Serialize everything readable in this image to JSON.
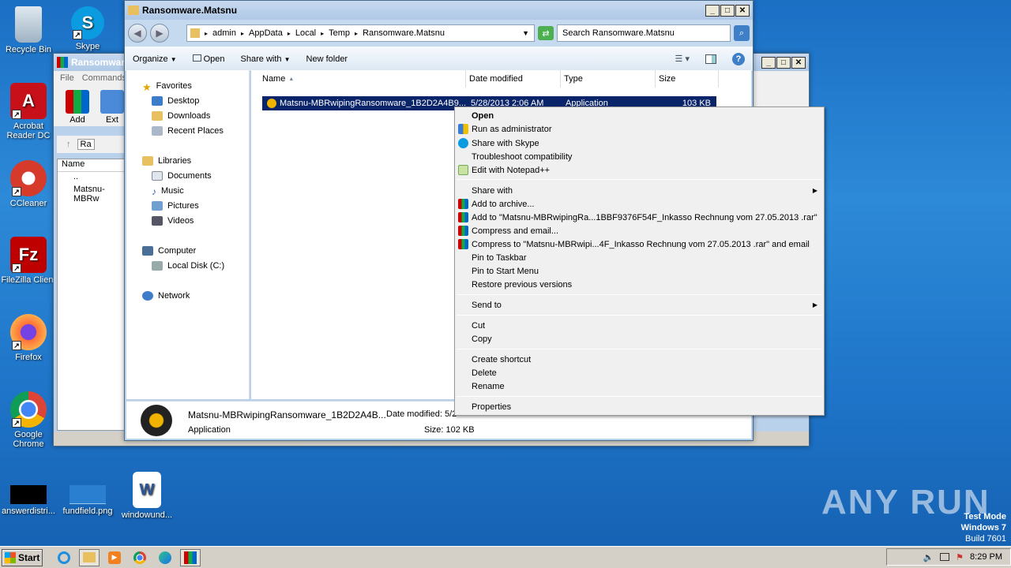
{
  "desktop": {
    "icons": [
      {
        "label": "Recycle Bin"
      },
      {
        "label": "Skype"
      },
      {
        "label": "Acrobat Reader DC"
      },
      {
        "label": "CCleaner"
      },
      {
        "label": "FileZilla Client"
      },
      {
        "label": "Firefox"
      },
      {
        "label": "Google Chrome"
      },
      {
        "label": "answerdistri..."
      },
      {
        "label": "fundfield.png"
      },
      {
        "label": "windowund..."
      }
    ],
    "watermark": "ANY RUN",
    "test_mode": [
      "Test Mode",
      "Windows 7",
      "Build 7601"
    ]
  },
  "rar_window": {
    "title": "Ransomware...",
    "menu": [
      "File",
      "Commands"
    ],
    "tools": [
      "Add",
      "Ext"
    ],
    "path_text": "Ra",
    "col_name": "Name",
    "rows": [
      "..",
      "Matsnu-MBRw"
    ]
  },
  "explorer": {
    "title": "Ransomware.Matsnu",
    "breadcrumb": [
      "admin",
      "AppData",
      "Local",
      "Temp",
      "Ransomware.Matsnu"
    ],
    "search_placeholder": "Search Ransomware.Matsnu",
    "commands": [
      "Organize",
      "Open",
      "Share with",
      "New folder"
    ],
    "nav": {
      "favorites": "Favorites",
      "fav_items": [
        "Desktop",
        "Downloads",
        "Recent Places"
      ],
      "libraries": "Libraries",
      "lib_items": [
        "Documents",
        "Music",
        "Pictures",
        "Videos"
      ],
      "computer": "Computer",
      "comp_items": [
        "Local Disk (C:)"
      ],
      "network": "Network"
    },
    "columns": [
      "Name",
      "Date modified",
      "Type",
      "Size"
    ],
    "file": {
      "name": "Matsnu-MBRwipingRansomware_1B2D2A4B9...",
      "date": "5/28/2013 2:06 AM",
      "type": "Application",
      "size": "103 KB"
    },
    "details": {
      "name": "Matsnu-MBRwipingRansomware_1B2D2A4B...",
      "date_label": "Date modified: 5/2",
      "type": "Application",
      "size_label": "Size: 102 KB"
    }
  },
  "context_menu": {
    "items": [
      "Open",
      "Run as administrator",
      "Share with Skype",
      "Troubleshoot compatibility",
      "Edit with Notepad++",
      "Share with",
      "Add to archive...",
      "Add to \"Matsnu-MBRwipingRa...1BBF9376F54F_Inkasso Rechnung vom 27.05.2013 .rar\"",
      "Compress and email...",
      "Compress to \"Matsnu-MBRwipi...4F_Inkasso Rechnung vom 27.05.2013 .rar\" and email",
      "Pin to Taskbar",
      "Pin to Start Menu",
      "Restore previous versions",
      "Send to",
      "Cut",
      "Copy",
      "Create shortcut",
      "Delete",
      "Rename",
      "Properties"
    ]
  },
  "taskbar": {
    "start": "Start",
    "clock": "8:29 PM"
  }
}
